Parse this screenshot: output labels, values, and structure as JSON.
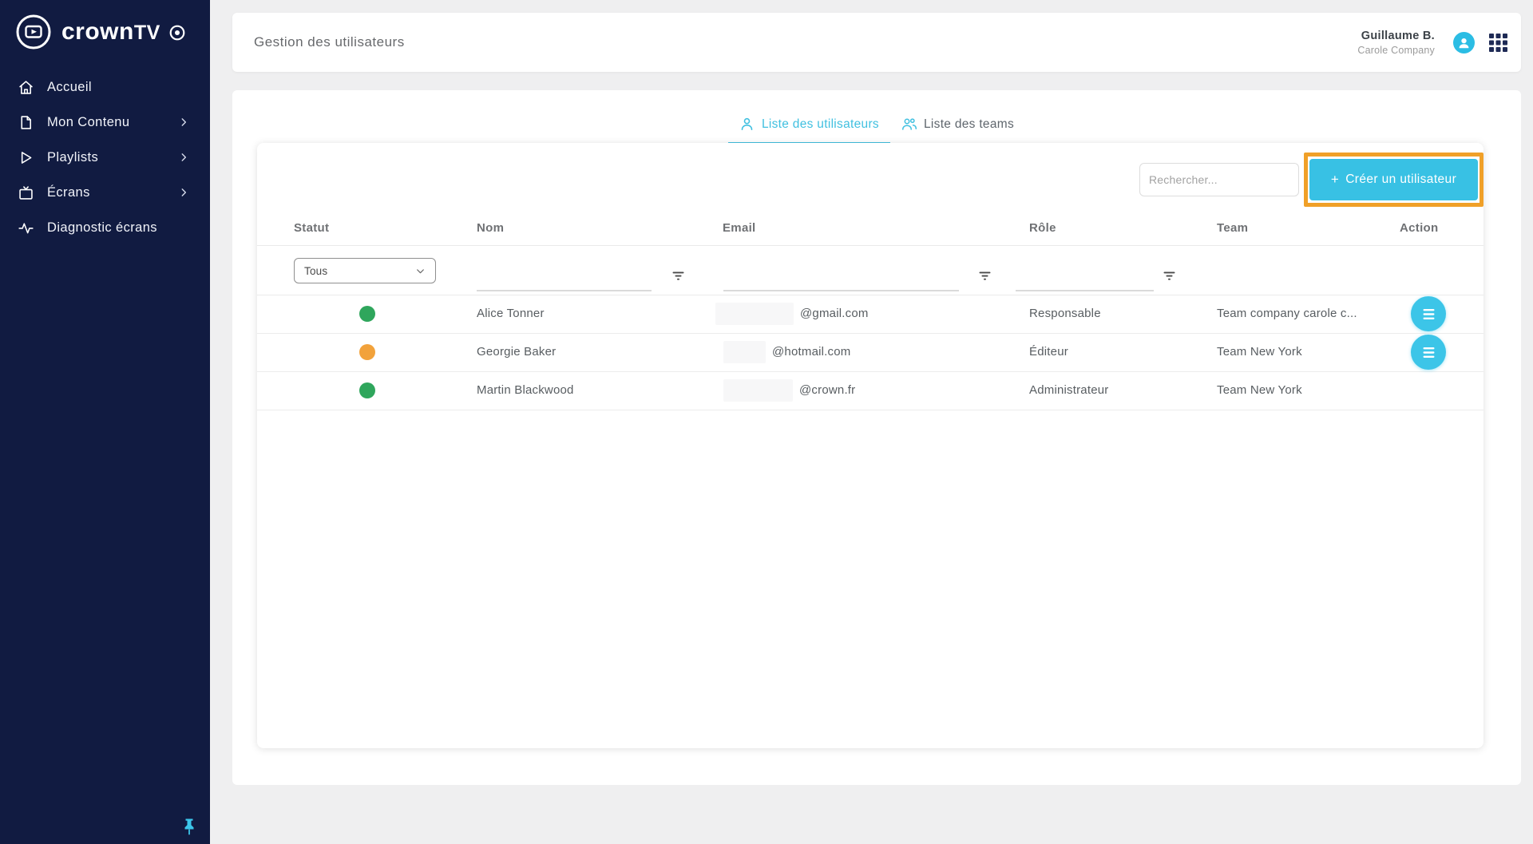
{
  "brand": {
    "name_primary": "crown",
    "name_secondary": "TV"
  },
  "sidebar": {
    "items": [
      {
        "label": "Accueil",
        "icon": "home-icon",
        "has_submenu": false
      },
      {
        "label": "Mon Contenu",
        "icon": "document-icon",
        "has_submenu": true
      },
      {
        "label": "Playlists",
        "icon": "play-icon",
        "has_submenu": true
      },
      {
        "label": "Écrans",
        "icon": "tv-icon",
        "has_submenu": true
      },
      {
        "label": "Diagnostic écrans",
        "icon": "pulse-icon",
        "has_submenu": false
      }
    ]
  },
  "header": {
    "title": "Gestion des utilisateurs",
    "user": {
      "name": "Guillaume B.",
      "company": "Carole Company"
    }
  },
  "tabs": [
    {
      "label": "Liste des utilisateurs",
      "icon": "person-icon",
      "active": true
    },
    {
      "label": "Liste des teams",
      "icon": "people-icon",
      "active": false
    }
  ],
  "toolbar": {
    "search_placeholder": "Rechercher...",
    "create_plus": "+",
    "create_label": "Créer un utilisateur"
  },
  "table": {
    "columns": [
      "Statut",
      "Nom",
      "Email",
      "Rôle",
      "Team",
      "Action"
    ],
    "filters": {
      "status_selected": "Tous"
    },
    "rows": [
      {
        "status_color": "#2fa65c",
        "name": "Alice Tonner",
        "email_domain": "@gmail.com",
        "role": "Responsable",
        "team": "Team company carole c...",
        "has_action": true
      },
      {
        "status_color": "#f2a23b",
        "name": "Georgie Baker",
        "email_domain": "@hotmail.com",
        "role": "Éditeur",
        "team": "Team New York",
        "has_action": true
      },
      {
        "status_color": "#2fa65c",
        "name": "Martin Blackwood",
        "email_domain": "@crown.fr",
        "role": "Administrateur",
        "team": "Team New York",
        "has_action": false
      }
    ]
  },
  "colors": {
    "accent_cyan": "#38c1e4",
    "highlight_orange": "#f0a028",
    "sidebar_navy": "#111b41",
    "status_green": "#2fa65c",
    "status_orange": "#f2a23b"
  }
}
